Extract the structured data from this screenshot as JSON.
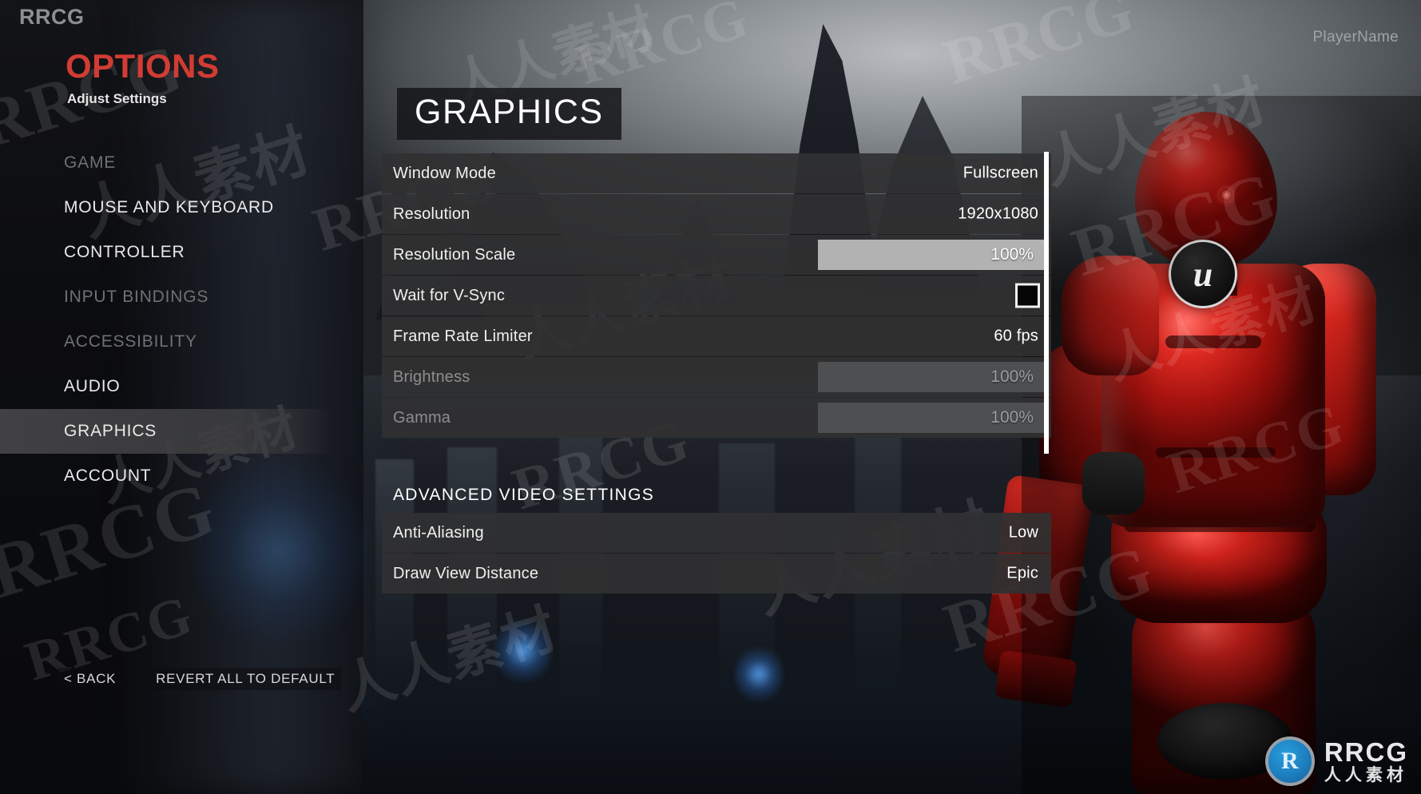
{
  "brand": "RRCG",
  "options": {
    "title": "OPTIONS",
    "subtitle": "Adjust Settings"
  },
  "player": {
    "name": "PlayerName"
  },
  "sidebar": {
    "items": [
      {
        "label": "GAME",
        "state": "dim"
      },
      {
        "label": "MOUSE AND KEYBOARD",
        "state": "normal"
      },
      {
        "label": "CONTROLLER",
        "state": "normal"
      },
      {
        "label": "INPUT BINDINGS",
        "state": "dim"
      },
      {
        "label": "ACCESSIBILITY",
        "state": "dim"
      },
      {
        "label": "AUDIO",
        "state": "normal"
      },
      {
        "label": "GRAPHICS",
        "state": "active"
      },
      {
        "label": "ACCOUNT",
        "state": "normal"
      }
    ]
  },
  "footer": {
    "back_label": "< BACK",
    "revert_label": "REVERT ALL TO DEFAULT"
  },
  "main": {
    "section_title": "GRAPHICS",
    "advanced_heading": "ADVANCED VIDEO SETTINGS",
    "settings": [
      {
        "label": "Window Mode",
        "value": "Fullscreen",
        "control": "value",
        "disabled": false
      },
      {
        "label": "Resolution",
        "value": "1920x1080",
        "control": "value",
        "disabled": false
      },
      {
        "label": "Resolution Scale",
        "value": "100%",
        "control": "slider",
        "disabled": false,
        "fill": 100
      },
      {
        "label": "Wait for V-Sync",
        "value": "",
        "control": "checkbox",
        "disabled": false,
        "checked": false
      },
      {
        "label": "Frame Rate Limiter",
        "value": "60 fps",
        "control": "value",
        "disabled": false
      },
      {
        "label": "Brightness",
        "value": "100%",
        "control": "slider",
        "disabled": true,
        "fill": 100
      },
      {
        "label": "Gamma",
        "value": "100%",
        "control": "slider",
        "disabled": true,
        "fill": 100
      }
    ],
    "advanced_settings": [
      {
        "label": "Anti-Aliasing",
        "value": "Low",
        "control": "value",
        "disabled": false
      },
      {
        "label": "Draw View Distance",
        "value": "Epic",
        "control": "value",
        "disabled": false
      }
    ]
  },
  "character": {
    "chest_logo_glyph": "u"
  },
  "corner_logo": {
    "mark_glyph": "R",
    "name": "RRCG",
    "tagline": "人人素材"
  },
  "watermarks": {
    "latin": "RRCG",
    "cn": "人人素材"
  },
  "colors": {
    "accent_red": "#d23c34",
    "row_bg": "#303032",
    "slider_active": "#b2b2b2",
    "slider_disabled": "#4e4f51",
    "text_primary": "#f0f0f0",
    "text_dim": "#8b8e91",
    "logo_blue": "#2a9ddb"
  }
}
